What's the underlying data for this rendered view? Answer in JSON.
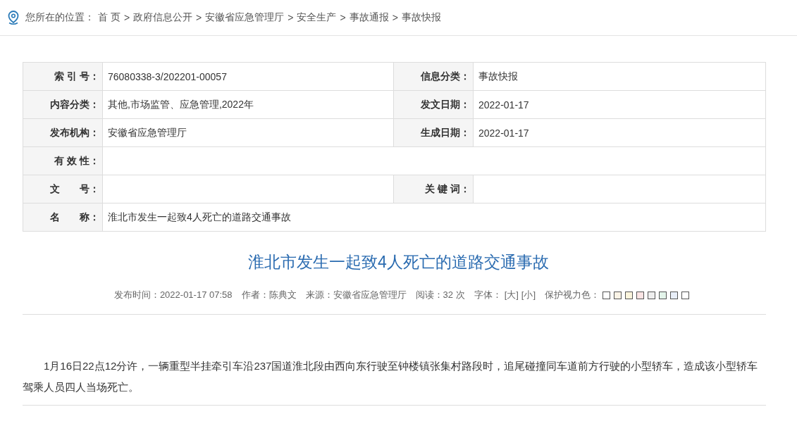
{
  "breadcrumb": {
    "prefix": "您所在的位置：",
    "items": [
      "首 页",
      "政府信息公开",
      "安徽省应急管理厅",
      "安全生产",
      "事故通报",
      "事故快报"
    ],
    "separator": ">"
  },
  "info_table": {
    "rows": [
      {
        "kind": "pair",
        "label": "索 引 号：",
        "value": "76080338-3/202201-00057",
        "label2": "信息分类：",
        "value2": "事故快报"
      },
      {
        "kind": "pair",
        "label": "内容分类：",
        "value": "其他,市场监管、应急管理,2022年",
        "label2": "发文日期：",
        "value2": "2022-01-17"
      },
      {
        "kind": "pair",
        "label": "发布机构：",
        "value": "安徽省应急管理厅",
        "label2": "生成日期：",
        "value2": "2022-01-17"
      },
      {
        "kind": "wide",
        "label": "有 效 性："
      },
      {
        "kind": "pair",
        "label": "文　　号：",
        "label2": "关 键 词："
      },
      {
        "kind": "wide",
        "label": "名　　称：",
        "value": "淮北市发生一起致4人死亡的道路交通事故"
      }
    ]
  },
  "article": {
    "title": "淮北市发生一起致4人死亡的道路交通事故",
    "meta": {
      "published": "发布时间：2022-01-17 07:58",
      "author": "作者：陈典文",
      "source": "来源：安徽省应急管理厅",
      "reads": "阅读：32 次",
      "font_label": "字体：",
      "font_large": "[大]",
      "font_small": "[小]",
      "eye_care_label": "保护视力色：",
      "eye_care_colors": [
        {
          "color": "#ffffff"
        },
        {
          "color": "#faf3e6"
        },
        {
          "color": "#fbf4dc"
        },
        {
          "color": "#fbe4e4"
        },
        {
          "color": "#eeeeee"
        },
        {
          "color": "#e3f4ea"
        },
        {
          "color": "#e8eef8"
        },
        {
          "color": "#ffffff"
        }
      ]
    },
    "body": "1月16日22点12分许，一辆重型半挂牵引车沿237国道淮北段由西向东行驶至钟楼镇张集村路段时，追尾碰撞同车道前方行驶的小型轿车，造成该小型轿车驾乘人员四人当场死亡。"
  }
}
